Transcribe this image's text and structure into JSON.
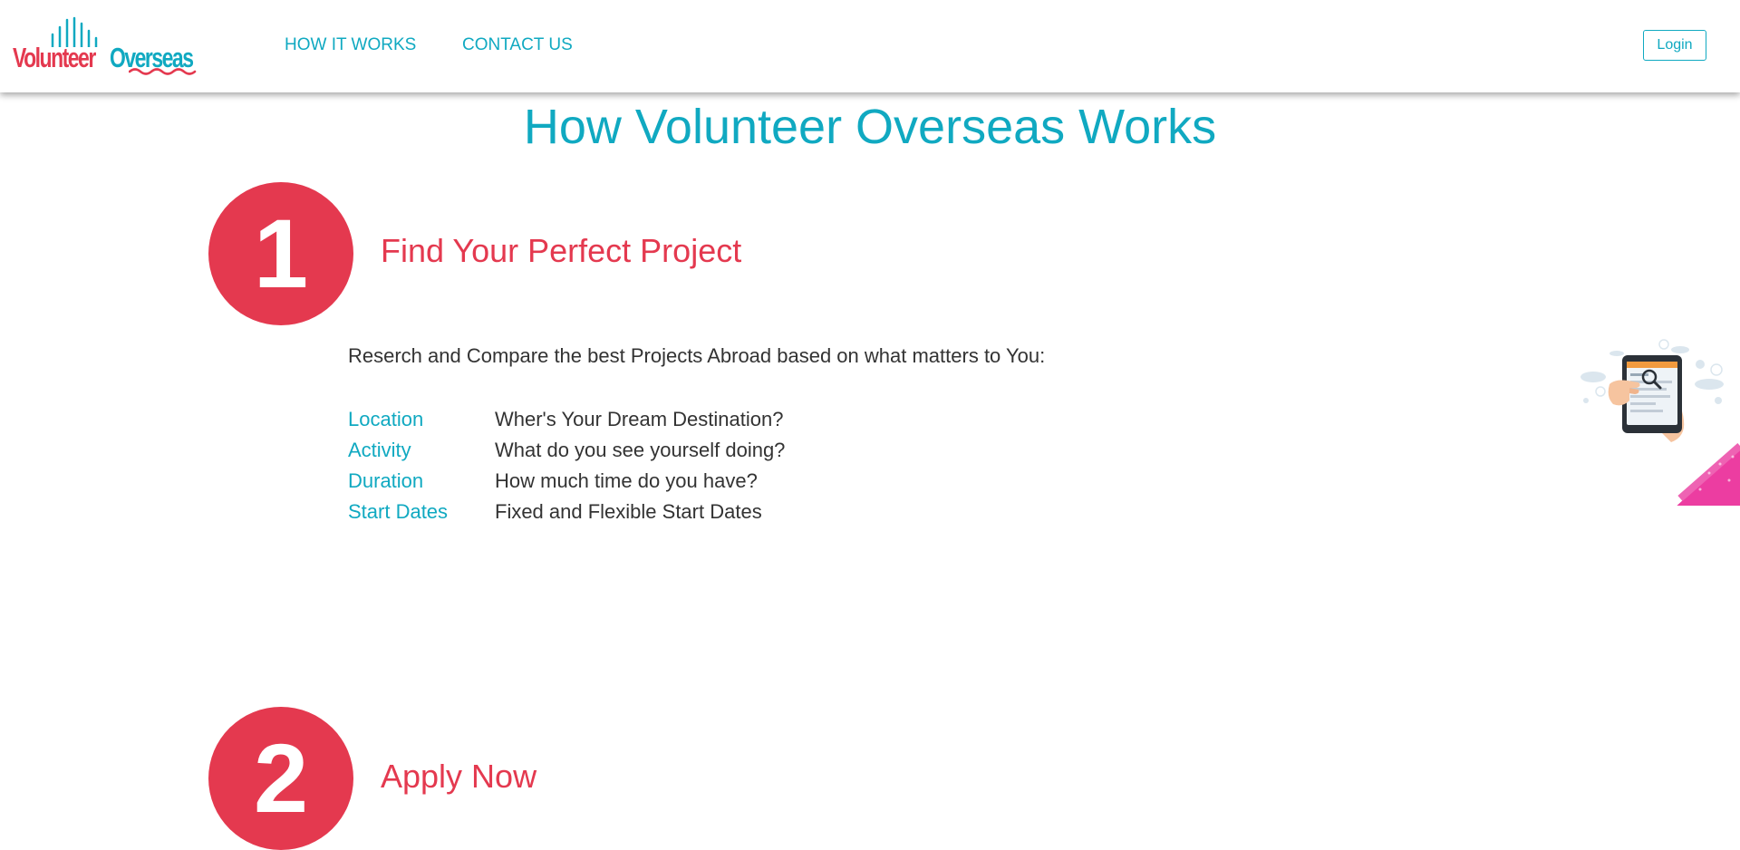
{
  "header": {
    "logo": {
      "word1": "Volunteer",
      "word2": "Overseas"
    },
    "nav": [
      {
        "label": "HOW IT WORKS"
      },
      {
        "label": "CONTACT US"
      }
    ],
    "login_label": "Login"
  },
  "main": {
    "title": "How Volunteer Overseas Works",
    "steps": [
      {
        "number": "1",
        "heading": "Find Your Perfect Project",
        "intro": "Reserch and Compare the best Projects Abroad based on what matters to You:",
        "criteria": [
          {
            "label": "Location",
            "desc": "Wher's Your Dream Destination?"
          },
          {
            "label": "Activity",
            "desc": "What do you see yourself doing?"
          },
          {
            "label": "Duration",
            "desc": "How much time do you have?"
          },
          {
            "label": "Start Dates",
            "desc": "Fixed and Flexible Start Dates"
          }
        ]
      },
      {
        "number": "2",
        "heading": "Apply Now"
      }
    ]
  },
  "colors": {
    "brand_red": "#e4394f",
    "brand_teal": "#10a9c1",
    "body_text": "#333333"
  },
  "icons": [
    "logo-bars-icon",
    "logo-wave-icon",
    "hand-holding-tablet-illustration"
  ]
}
